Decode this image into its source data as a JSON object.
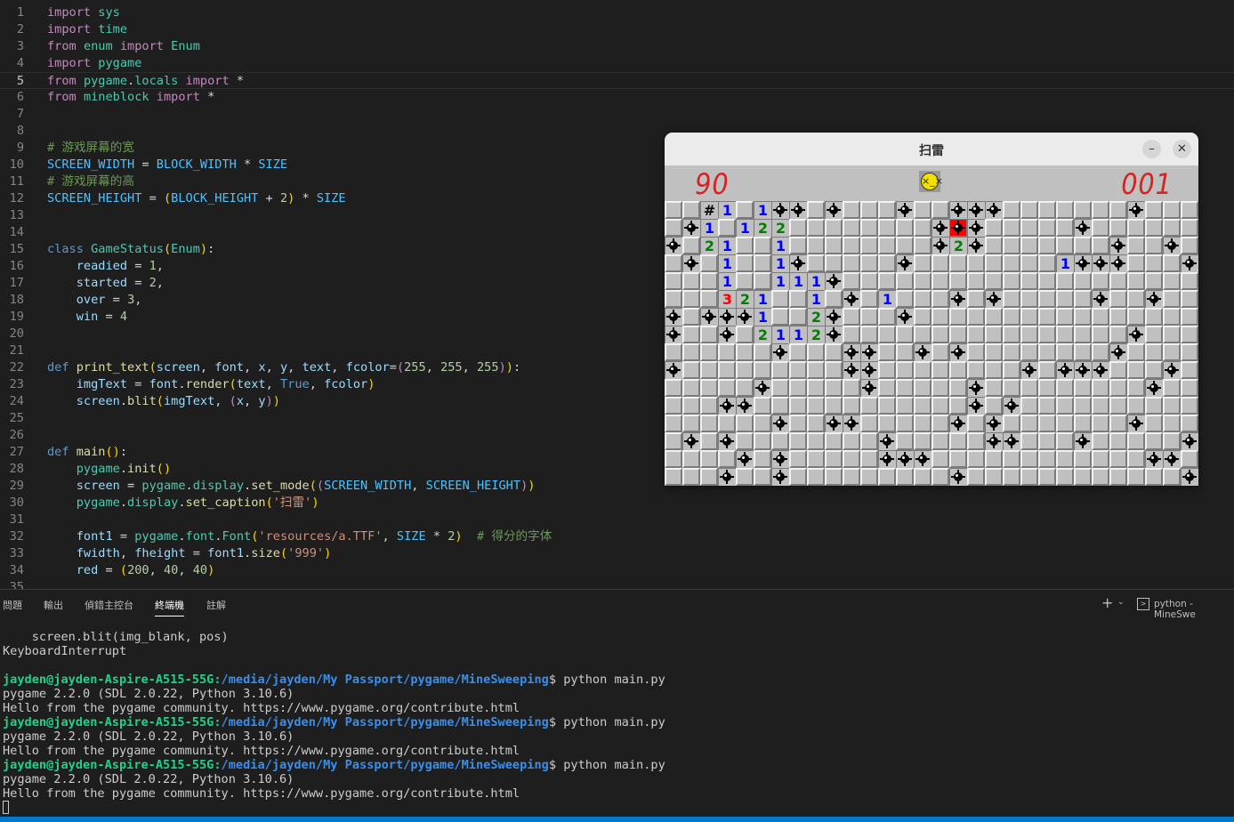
{
  "editor": {
    "lines": [
      {
        "n": "1",
        "html": "<span class=\"kw\">import</span> <span class=\"t\">sys</span>"
      },
      {
        "n": "2",
        "html": "<span class=\"kw\">import</span> <span class=\"t\">time</span>"
      },
      {
        "n": "3",
        "html": "<span class=\"kw\">from</span> <span class=\"t\">enum</span> <span class=\"kw\">import</span> <span class=\"t\">Enum</span>"
      },
      {
        "n": "4",
        "html": "<span class=\"kw\">import</span> <span class=\"t\">pygame</span>"
      },
      {
        "n": "5",
        "html": "<span class=\"kw\">from</span> <span class=\"t\">pygame</span>.<span class=\"t\">locals</span> <span class=\"kw\">import</span> *",
        "current": true
      },
      {
        "n": "6",
        "html": "<span class=\"kw\">from</span> <span class=\"t\">mineblock</span> <span class=\"kw\">import</span> *"
      },
      {
        "n": "7",
        "html": ""
      },
      {
        "n": "8",
        "html": ""
      },
      {
        "n": "9",
        "html": "<span class=\"c\"># 游戏屏幕的宽</span>"
      },
      {
        "n": "10",
        "html": "<span class=\"cn\">SCREEN_WIDTH</span> = <span class=\"cn\">BLOCK_WIDTH</span> * <span class=\"cn\">SIZE</span>"
      },
      {
        "n": "11",
        "html": "<span class=\"c\"># 游戏屏幕的高</span>"
      },
      {
        "n": "12",
        "html": "<span class=\"cn\">SCREEN_HEIGHT</span> = <span class=\"p\">(</span><span class=\"cn\">BLOCK_HEIGHT</span> + <span class=\"n\">2</span><span class=\"p\">)</span> * <span class=\"cn\">SIZE</span>"
      },
      {
        "n": "13",
        "html": ""
      },
      {
        "n": "14",
        "html": ""
      },
      {
        "n": "15",
        "html": "<span class=\"k\">class</span> <span class=\"t\">GameStatus</span><span class=\"p\">(</span><span class=\"t\">Enum</span><span class=\"p\">)</span>:"
      },
      {
        "n": "16",
        "html": "    <span class=\"v\">readied</span> = <span class=\"n\">1</span>,"
      },
      {
        "n": "17",
        "html": "    <span class=\"v\">started</span> = <span class=\"n\">2</span>,"
      },
      {
        "n": "18",
        "html": "    <span class=\"v\">over</span> = <span class=\"n\">3</span>,"
      },
      {
        "n": "19",
        "html": "    <span class=\"v\">win</span> = <span class=\"n\">4</span>"
      },
      {
        "n": "20",
        "html": ""
      },
      {
        "n": "21",
        "html": ""
      },
      {
        "n": "22",
        "html": "<span class=\"k\">def</span> <span class=\"f\">print_text</span><span class=\"p\">(</span><span class=\"v\">screen</span>, <span class=\"v\">font</span>, <span class=\"v\">x</span>, <span class=\"v\">y</span>, <span class=\"v\">text</span>, <span class=\"v\">fcolor</span>=<span class=\"kw\">(</span><span class=\"n\">255</span>, <span class=\"n\">255</span>, <span class=\"n\">255</span><span class=\"kw\">)</span><span class=\"p\">)</span>:"
      },
      {
        "n": "23",
        "html": "    <span class=\"v\">imgText</span> = <span class=\"v\">font</span>.<span class=\"f\">render</span><span class=\"p\">(</span><span class=\"v\">text</span>, <span class=\"k\">True</span>, <span class=\"v\">fcolor</span><span class=\"p\">)</span>"
      },
      {
        "n": "24",
        "html": "    <span class=\"v\">screen</span>.<span class=\"f\">blit</span><span class=\"p\">(</span><span class=\"v\">imgText</span>, <span class=\"kw\">(</span><span class=\"v\">x</span>, <span class=\"v\">y</span><span class=\"kw\">)</span><span class=\"p\">)</span>"
      },
      {
        "n": "25",
        "html": ""
      },
      {
        "n": "26",
        "html": ""
      },
      {
        "n": "27",
        "html": "<span class=\"k\">def</span> <span class=\"f\">main</span><span class=\"p\">()</span>:"
      },
      {
        "n": "28",
        "html": "    <span class=\"t\">pygame</span>.<span class=\"f\">init</span><span class=\"p\">()</span>"
      },
      {
        "n": "29",
        "html": "    <span class=\"v\">screen</span> = <span class=\"t\">pygame</span>.<span class=\"t\">display</span>.<span class=\"f\">set_mode</span><span class=\"p\">(</span><span class=\"kw\">(</span><span class=\"cn\">SCREEN_WIDTH</span>, <span class=\"cn\">SCREEN_HEIGHT</span><span class=\"kw\">)</span><span class=\"p\">)</span>"
      },
      {
        "n": "30",
        "html": "    <span class=\"t\">pygame</span>.<span class=\"t\">display</span>.<span class=\"f\">set_caption</span><span class=\"p\">(</span><span class=\"s\">'扫雷'</span><span class=\"p\">)</span>"
      },
      {
        "n": "31",
        "html": ""
      },
      {
        "n": "32",
        "html": "    <span class=\"v\">font1</span> = <span class=\"t\">pygame</span>.<span class=\"t\">font</span>.<span class=\"t\">Font</span><span class=\"p\">(</span><span class=\"s\">'resources/a.TTF'</span>, <span class=\"cn\">SIZE</span> * <span class=\"n\">2</span><span class=\"p\">)</span>  <span class=\"c\"># 得分的字体</span>"
      },
      {
        "n": "33",
        "html": "    <span class=\"v\">fwidth</span>, <span class=\"v\">fheight</span> = <span class=\"v\">font1</span>.<span class=\"f\">size</span><span class=\"p\">(</span><span class=\"s\">'999'</span><span class=\"p\">)</span>"
      },
      {
        "n": "34",
        "html": "    <span class=\"v\">red</span> = <span class=\"p\">(</span><span class=\"n\">200</span>, <span class=\"n\">40</span>, <span class=\"n\">40</span><span class=\"p\">)</span>"
      },
      {
        "n": "35",
        "html": ""
      }
    ]
  },
  "panel": {
    "tabs": [
      "問題",
      "輸出",
      "偵錯主控台",
      "終端機",
      "註解"
    ],
    "active_tab": "終端機",
    "add_terminal": "+",
    "terminal_title": "python - MineSwe"
  },
  "terminal": {
    "lines": [
      {
        "text": "    screen.blit(img_blank, pos)"
      },
      {
        "text": "KeyboardInterrupt"
      },
      {
        "text": ""
      },
      {
        "user": "jayden@jayden-Aspire-A515-55G",
        "path": "/media/jayden/My Passport/pygame/MineSweeping",
        "cmd": "$ python main.py"
      },
      {
        "text": "pygame 2.2.0 (SDL 2.0.22, Python 3.10.6)"
      },
      {
        "text": "Hello from the pygame community. https://www.pygame.org/contribute.html"
      },
      {
        "user": "jayden@jayden-Aspire-A515-55G",
        "path": "/media/jayden/My Passport/pygame/MineSweeping",
        "cmd": "$ python main.py"
      },
      {
        "text": "pygame 2.2.0 (SDL 2.0.22, Python 3.10.6)"
      },
      {
        "text": "Hello from the pygame community. https://www.pygame.org/contribute.html"
      },
      {
        "user": "jayden@jayden-Aspire-A515-55G",
        "path": "/media/jayden/My Passport/pygame/MineSweeping",
        "cmd": "$ python main.py"
      },
      {
        "text": "pygame 2.2.0 (SDL 2.0.22, Python 3.10.6)"
      },
      {
        "text": "Hello from the pygame community. https://www.pygame.org/contribute.html"
      }
    ]
  },
  "game": {
    "title": "扫雷",
    "minimize_icon": "minus-icon",
    "close_icon": "close-icon",
    "minimize_glyph": "–",
    "close_glyph": "✕",
    "mines_counter": "90",
    "timer": "001",
    "face": "dead-face-icon",
    "face_glyph": "×_×",
    "colors": {
      "1": "#0000ff",
      "2": "#008000",
      "3": "#ff0000",
      "counter": "#d42323"
    },
    "board": [
      "..#1.1**.*...*..***.......*...",
      ".*1.122........*O*.....*......",
      "*.21..1........*2*.......*..*.",
      ".*.1..1*.....*........1***...**",
      "...1..111*....................",
      "...321..1.*.1...*.*.....*..*..",
      "*.***1..2*...*...............",
      "*..*.2112*................*...",
      "......*...**..*.*........*...",
      "*.........**........*.***...*.",
      ".....*.....*.....*.........*.",
      "...**............*.*..........",
      "......*..**.....*.*.......*...",
      ".*.*........*.....**...*.....*.",
      "....*.*.....***............**.*",
      "...*..*.........*............*."
    ]
  }
}
